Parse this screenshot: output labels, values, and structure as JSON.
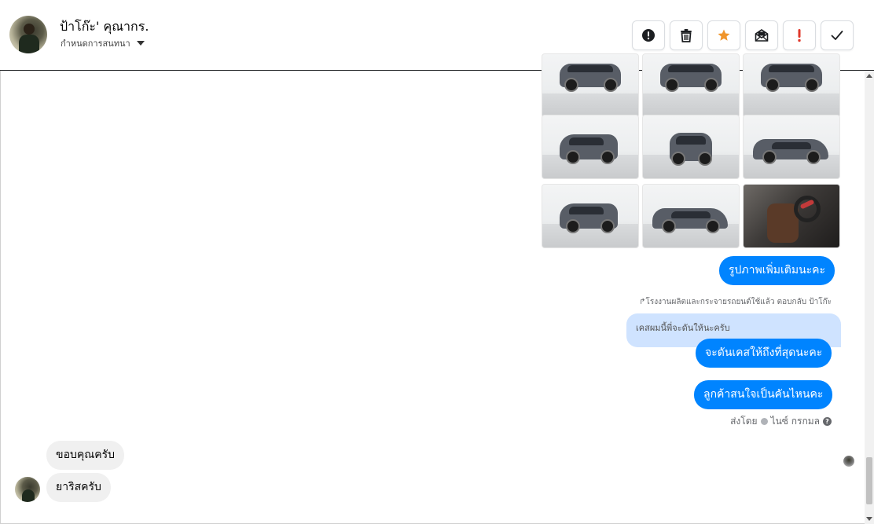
{
  "header": {
    "contact_name": "ป้าโก๊ะ' คุณากร.",
    "subtitle": "กำหนดการสนทนา",
    "actions": [
      {
        "name": "report-button",
        "icon": "exclamation-circle-icon"
      },
      {
        "name": "delete-button",
        "icon": "trash-icon"
      },
      {
        "name": "star-button",
        "icon": "star-icon",
        "color": "#f0952b"
      },
      {
        "name": "mark-unread-button",
        "icon": "envelope-open-icon"
      },
      {
        "name": "flag-button",
        "icon": "exclamation-icon",
        "color": "#e0382b"
      },
      {
        "name": "done-button",
        "icon": "checkmark-icon"
      }
    ]
  },
  "photos": [
    {
      "view": "front"
    },
    {
      "view": "front"
    },
    {
      "view": "front"
    },
    {
      "view": "rear-quarter"
    },
    {
      "view": "rear"
    },
    {
      "view": "side"
    },
    {
      "view": "rear-quarter"
    },
    {
      "view": "side"
    },
    {
      "view": "interior"
    }
  ],
  "messages": {
    "out1": "รูปภาพเพิ่มเติมนะคะ",
    "reply_note": "↱โรงงานผลิตและกระจายรถยนต์ใช้แล้ว ตอบกลับ ป้าโก๊ะ",
    "quoted": "เคสผมนี้พี่จะดันให้นะครับ",
    "out2": "จะดันเคสให้ถึงที่สุดนะคะ",
    "out3": "ลูกค้าสนใจเป็นคันไหนคะ",
    "sent_by_label": "ส่งโดย",
    "sent_by_name": "ไนซ์ กรกมล",
    "in1": "ขอบคุณครับ",
    "in2": "ยาริสครับ"
  },
  "colors": {
    "outgoing_bubble": "#0084ff",
    "incoming_bubble": "#f0f0f0",
    "quoted_bubble": "#cfe3ff"
  }
}
